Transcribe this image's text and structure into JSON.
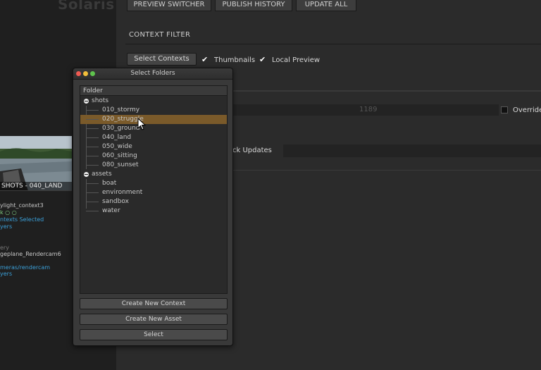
{
  "app": {
    "title": "Solaris"
  },
  "toolbar": {
    "buttons": [
      {
        "label": "PREVIEW SWITCHER"
      },
      {
        "label": "PUBLISH HISTORY"
      },
      {
        "label": "UPDATE ALL"
      }
    ]
  },
  "context_filter": {
    "section_label": "CONTEXT FILTER",
    "select_contexts_label": "Select Contexts",
    "thumbnails_label": "Thumbnails",
    "thumbnails_checked": true,
    "local_preview_label": "Local Preview",
    "local_preview_checked": true
  },
  "render_panel": {
    "slider_value": "1189",
    "override_label": "Override",
    "lock_updates_label": "ck Updates"
  },
  "left_panel": {
    "thumbnail_caption": "SHOTS - 040_LAND",
    "lines": [
      {
        "text": "ylight_context3",
        "color": "white"
      },
      {
        "text": "k ○ ○",
        "color": "green"
      },
      {
        "text": "ntexts Selected",
        "color": "blue"
      },
      {
        "text": "yers",
        "color": "blue"
      },
      {
        "text": "ery",
        "color": "gray"
      },
      {
        "text": "geplane_Rendercam6",
        "color": "white"
      },
      {
        "text": "meras/rendercam",
        "color": "blue"
      },
      {
        "text": "yers",
        "color": "blue"
      }
    ]
  },
  "dialog": {
    "title": "Select Folders",
    "tree_header": "Folder",
    "groups": [
      {
        "name": "shots",
        "items": [
          "010_stormy",
          "020_struggle",
          "030_ground",
          "040_land",
          "050_wide",
          "060_sitting",
          "080_sunset"
        ]
      },
      {
        "name": "assets",
        "items": [
          "boat",
          "environment",
          "sandbox",
          "water"
        ]
      }
    ],
    "selected_item": "020_struggle",
    "buttons": {
      "create_context": "Create New Context",
      "create_asset": "Create New Asset",
      "select": "Select"
    }
  },
  "colors": {
    "selection": "#7a5a2a",
    "link_blue": "#3ba0d9",
    "status_green": "#7fc97f"
  }
}
